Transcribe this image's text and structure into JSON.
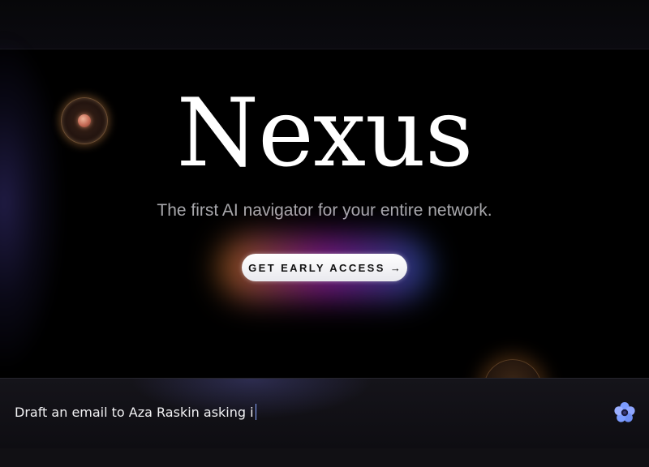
{
  "hero": {
    "title": "Nexus",
    "subtitle": "The first AI navigator for your entire network."
  },
  "cta": {
    "label": "GET EARLY ACCESS",
    "arrow": "→"
  },
  "prompt": {
    "value": "Draft an email to Aza Raskin asking i"
  },
  "icons": {
    "decorative_orb_left": "orb-icon",
    "decorative_orb_right": "orb-icon",
    "assistant": "flower-icon"
  },
  "colors": {
    "background": "#000000",
    "cta_gradient": [
      "#ff9628",
      "#c828dc",
      "#3c78ff"
    ],
    "flower_petal": "#7c9cff",
    "flower_center": "#1a1a40"
  }
}
